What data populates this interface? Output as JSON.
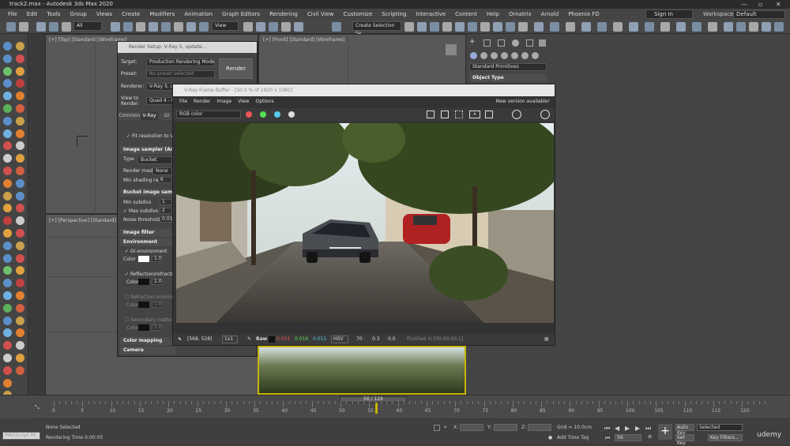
{
  "window": {
    "title": "track2.max - Autodesk 3ds Max 2020"
  },
  "menu": [
    "File",
    "Edit",
    "Tools",
    "Group",
    "Views",
    "Create",
    "Modifiers",
    "Animation",
    "Graph Editors",
    "Rendering",
    "Civil View",
    "Customize",
    "Scripting",
    "Interactive",
    "Content",
    "Help",
    "Ornatrix",
    "Arnold",
    "Phoenix FD"
  ],
  "account": {
    "signin": "Sign In",
    "workspaces_label": "Workspaces:",
    "workspace_value": "Default"
  },
  "toolbar": {
    "filter": "All",
    "view": "View",
    "selection_set": "Create Selection Se"
  },
  "viewports": {
    "top_label": "[+] [Top] [Standard] [Wireframe]",
    "front_label": "[+] [Front] [Standard] [Wireframe]",
    "perspective_label": "[+] [Perspective] [Standard] [Wi"
  },
  "command_panel": {
    "dropdown": "Standard Primitives",
    "section": "Object Type"
  },
  "render_setup": {
    "title": "Render Setup: V-Ray 5, update...",
    "target_label": "Target:",
    "target_value": "Production Rendering Mode",
    "preset_label": "Preset:",
    "preset_value": "No preset selected",
    "renderer_label": "Renderer:",
    "renderer_value": "V-Ray 5, up",
    "view_label_1": "View to",
    "view_label_2": "Render:",
    "view_value": "Quad 4 - Ca",
    "render_button": "Render",
    "tabs": [
      "Common",
      "V-Ray",
      "GI"
    ],
    "fit_vfb": "Fit resolution to VFB",
    "image_sampler": "Image sampler (An",
    "type_label": "Type",
    "type_value": "Bucket",
    "render_mask_label": "Render mask",
    "render_mask_value": "None",
    "min_shading_label": "Min shading rate",
    "min_shading_value": "6",
    "bucket_sampler": "Bucket image samp",
    "min_subdivs_label": "Min subdivs",
    "min_subdivs_value": "1",
    "max_subdivs_label": "Max subdivs",
    "max_subdivs_value": "2",
    "noise_label": "Noise threshold",
    "noise_value": "0.01",
    "image_filter": "Image filter",
    "environment": "Environment",
    "gi_env": "GI environment",
    "color_label": "Color",
    "color_value": "1.0",
    "reflection_env": "Reflection/refraction e",
    "refraction_env": "Refraction environme",
    "secondary_matte": "Secondary matte envi",
    "color_mapping": "Color mapping",
    "camera": "Camera"
  },
  "vfb": {
    "title": "V-Ray Frame Buffer - [50.0 % of 1920 x 1080]",
    "menu": [
      "File",
      "Render",
      "Image",
      "View",
      "Options"
    ],
    "new_version": "New version available!",
    "channel": "RGB color",
    "status_coords": "[568, 528]",
    "zoom": "1x1",
    "raw_label": "Raw",
    "r_value": "0.015",
    "g_value": "0.016",
    "b_value": "0.011",
    "mode": "HSV",
    "h_value": "70",
    "s_value": "0.3",
    "v_value": "0.0",
    "finished": "Finished in [00:00:00.1]"
  },
  "timeline": {
    "frame": "56 / 124",
    "ticks": [
      "0",
      "5",
      "10",
      "15",
      "20",
      "25",
      "30",
      "35",
      "40",
      "45",
      "50",
      "55",
      "60",
      "65",
      "70",
      "75",
      "80",
      "85",
      "90",
      "95",
      "100",
      "105",
      "110",
      "115",
      "120"
    ]
  },
  "status": {
    "maxscript": "MAXScript Mi",
    "selection": "None Selected",
    "rendering_time": "Rendering Time  0:00:05",
    "x_label": "X:",
    "y_label": "Y:",
    "z_label": "Z:",
    "grid": "Grid = 10.0cm",
    "add_time_tag": "Add Time Tag",
    "auto_key": "Auto Key",
    "selected": "Selected",
    "set_key": "Set Key",
    "key_filters": "Key Filters...",
    "frame_field": "56",
    "watermark": "udemy"
  }
}
